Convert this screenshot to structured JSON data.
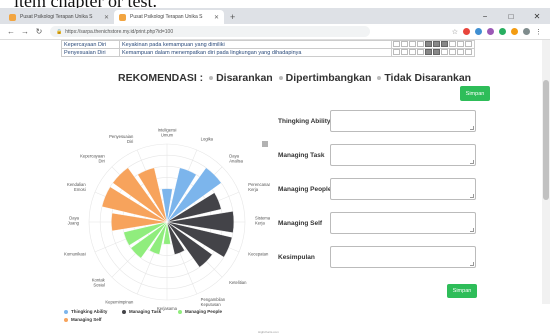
{
  "caption": "item chapter or test.",
  "browser": {
    "tabs": [
      {
        "label": "Pusat Psikologi Terapan Unika S",
        "active": false
      },
      {
        "label": "Pusat Psikologi Terapan Unika S",
        "active": true
      }
    ],
    "new_tab": "+",
    "url": "https://sarpa.thenichstore.my.id/print.php?id=100",
    "win_minimize": "−",
    "win_maximize": "□",
    "win_close": "✕"
  },
  "table": {
    "rows": [
      {
        "aspect": "Kepercayaan Diri",
        "desc": "Keyakinan pada kemampuan yang dimiliki",
        "dots": [
          0,
          0,
          0,
          0,
          1,
          1,
          1,
          0,
          0,
          0
        ]
      },
      {
        "aspect": "Penyesuaian Diri",
        "desc": "Kemampuan dalam menempatkan diri pada lingkungan yang dihadapinya",
        "dots": [
          0,
          0,
          0,
          0,
          1,
          1,
          0,
          0,
          0,
          0
        ]
      }
    ]
  },
  "rekomendasi": {
    "title": "REKOMENDASI :",
    "opt1": "Disarankan",
    "opt2": "Dipertimbangkan",
    "opt3": "Tidak Disarankan"
  },
  "buttons": {
    "save_top": "Simpan",
    "save_bottom": "Simpan"
  },
  "form": {
    "fields": [
      {
        "label": "Thingking Ability"
      },
      {
        "label": "Managing Task"
      },
      {
        "label": "Managing People"
      },
      {
        "label": "Managing Self"
      },
      {
        "label": "Kesimpulan"
      }
    ]
  },
  "credit": "Highcharts.com",
  "chart_data": {
    "type": "polar-column",
    "categories": [
      "Inteligensi Umum",
      "Logika",
      "Daya Analisa",
      "Perencanaan Kerja",
      "Sistematika Kerja",
      "Kecepatan",
      "Ketelitian",
      "Pengambilan Keputusan",
      "Kerjasama",
      "Kepemimpinan",
      "Kontak Sosial",
      "Komunikasi",
      "Daya Juang",
      "Kendalian Emosi",
      "Kepercayaan Diri",
      "Penyesuaian Diri"
    ],
    "values": [
      3,
      5,
      6,
      5,
      6,
      6,
      5,
      3,
      2,
      3,
      4,
      4,
      5,
      6,
      6,
      5
    ],
    "groups": [
      0,
      0,
      0,
      1,
      1,
      1,
      1,
      1,
      2,
      2,
      2,
      2,
      3,
      3,
      3,
      3
    ],
    "max": 7,
    "series": [
      {
        "name": "Thingking Ability",
        "color": "#7cb5ec"
      },
      {
        "name": "Managing Task",
        "color": "#434348"
      },
      {
        "name": "Managing People",
        "color": "#90ed7d"
      },
      {
        "name": "Managing Self",
        "color": "#f7a35c"
      }
    ]
  }
}
